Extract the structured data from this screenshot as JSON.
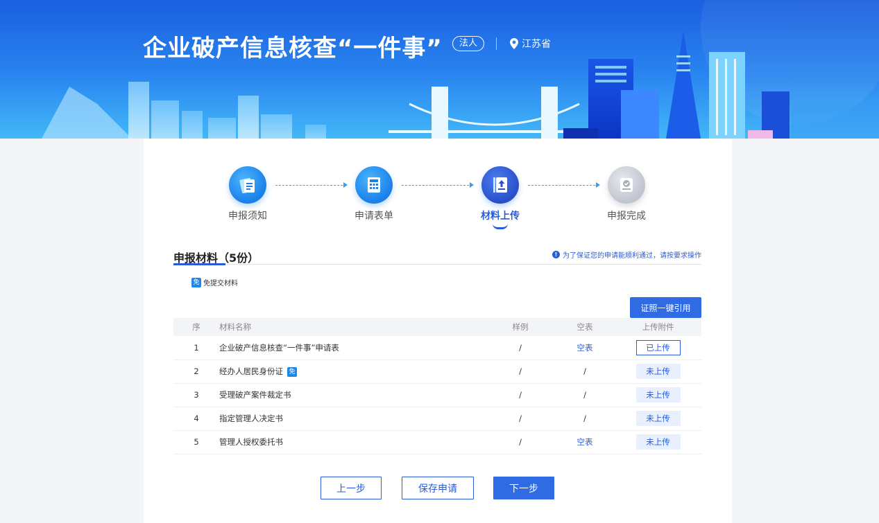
{
  "banner": {
    "title": "企业破产信息核查“一件事”",
    "role_tag": "法人",
    "location": "江苏省"
  },
  "steps": [
    {
      "label": "申报须知",
      "icon": "document-card-icon",
      "state": "done"
    },
    {
      "label": "申请表单",
      "icon": "form-grid-icon",
      "state": "done"
    },
    {
      "label": "材料上传",
      "icon": "upload-book-icon",
      "state": "active"
    },
    {
      "label": "申报完成",
      "icon": "check-badge-icon",
      "state": "pending"
    }
  ],
  "section": {
    "title": "申报材料（5份）",
    "notice": "为了保证您的申请能顺利通过，请按要求操作",
    "exempt_badge": "免",
    "exempt_legend": "免提交材料",
    "cite_button": "证照一键引用"
  },
  "table": {
    "headers": {
      "no": "序",
      "name": "材料名称",
      "sample": "样例",
      "blank": "空表",
      "upload": "上传附件"
    },
    "rows": [
      {
        "no": "1",
        "name": "企业破产信息核查“一件事”申请表",
        "exempt": "",
        "sample": "/",
        "blank": "空表",
        "upload": "已上传"
      },
      {
        "no": "2",
        "name": "经办人居民身份证",
        "exempt": "免",
        "sample": "/",
        "blank": "/",
        "upload": "未上传"
      },
      {
        "no": "3",
        "name": "受理破产案件裁定书",
        "exempt": "",
        "sample": "/",
        "blank": "/",
        "upload": "未上传"
      },
      {
        "no": "4",
        "name": "指定管理人决定书",
        "exempt": "",
        "sample": "/",
        "blank": "/",
        "upload": "未上传"
      },
      {
        "no": "5",
        "name": "管理人授权委托书",
        "exempt": "",
        "sample": "/",
        "blank": "空表",
        "upload": "未上传"
      }
    ]
  },
  "footer": {
    "prev": "上一步",
    "save": "保存申请",
    "next": "下一步"
  },
  "colors": {
    "primary": "#2f6be3",
    "accent": "#1f87e8",
    "banner_top": "#1a5fe0"
  }
}
